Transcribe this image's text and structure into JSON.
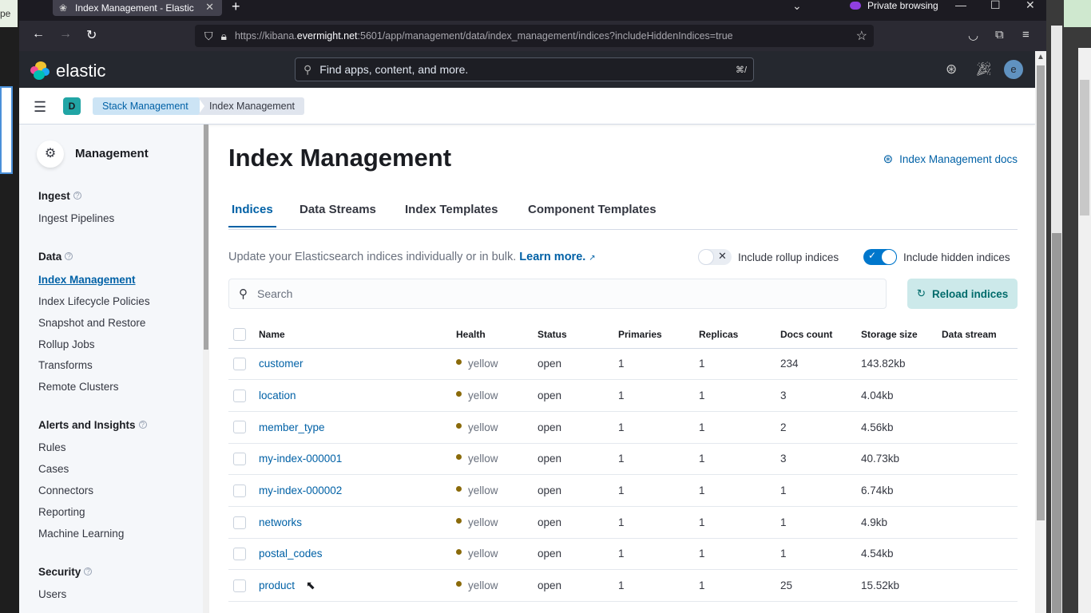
{
  "browser": {
    "tab_title": "Index Management - Elastic",
    "new_tab": "+",
    "private_label": "Private browsing",
    "url_prefix": "https://kibana.",
    "url_host": "evermight.net",
    "url_rest": ":5601/app/management/data/index_management/indices?includeHiddenIndices=true"
  },
  "left_strip_text": "pe",
  "kibana": {
    "logo_text": "elastic",
    "global_search_placeholder": "Find apps, content, and more.",
    "global_search_shortcut": "⌘/",
    "avatar_initial": "e",
    "space_initial": "D",
    "breadcrumbs": [
      "Stack Management",
      "Index Management"
    ]
  },
  "sidebar": {
    "title": "Management",
    "groups": [
      {
        "label": "Ingest",
        "items": [
          "Ingest Pipelines"
        ]
      },
      {
        "label": "Data",
        "items": [
          "Index Management",
          "Index Lifecycle Policies",
          "Snapshot and Restore",
          "Rollup Jobs",
          "Transforms",
          "Remote Clusters"
        ]
      },
      {
        "label": "Alerts and Insights",
        "items": [
          "Rules",
          "Cases",
          "Connectors",
          "Reporting",
          "Machine Learning"
        ]
      },
      {
        "label": "Security",
        "items": [
          "Users"
        ]
      }
    ],
    "active_item": "Index Management"
  },
  "main": {
    "title": "Index Management",
    "docs_link": "Index Management docs",
    "tabs": [
      "Indices",
      "Data Streams",
      "Index Templates",
      "Component Templates"
    ],
    "active_tab": "Indices",
    "description": "Update your Elasticsearch indices individually or in bulk.",
    "learn_more": "Learn more.",
    "toggle_rollup": {
      "label": "Include rollup indices",
      "on": false
    },
    "toggle_hidden": {
      "label": "Include hidden indices",
      "on": true
    },
    "search_placeholder": "Search",
    "search_value": "",
    "reload_button": "Reload indices"
  },
  "table": {
    "columns": [
      "Name",
      "Health",
      "Status",
      "Primaries",
      "Replicas",
      "Docs count",
      "Storage size",
      "Data stream"
    ],
    "rows": [
      {
        "name": "customer",
        "health": "yellow",
        "status": "open",
        "primaries": "1",
        "replicas": "1",
        "docs": "234",
        "size": "143.82kb",
        "stream": ""
      },
      {
        "name": "location",
        "health": "yellow",
        "status": "open",
        "primaries": "1",
        "replicas": "1",
        "docs": "3",
        "size": "4.04kb",
        "stream": ""
      },
      {
        "name": "member_type",
        "health": "yellow",
        "status": "open",
        "primaries": "1",
        "replicas": "1",
        "docs": "2",
        "size": "4.56kb",
        "stream": ""
      },
      {
        "name": "my-index-000001",
        "health": "yellow",
        "status": "open",
        "primaries": "1",
        "replicas": "1",
        "docs": "3",
        "size": "40.73kb",
        "stream": ""
      },
      {
        "name": "my-index-000002",
        "health": "yellow",
        "status": "open",
        "primaries": "1",
        "replicas": "1",
        "docs": "1",
        "size": "6.74kb",
        "stream": ""
      },
      {
        "name": "networks",
        "health": "yellow",
        "status": "open",
        "primaries": "1",
        "replicas": "1",
        "docs": "1",
        "size": "4.9kb",
        "stream": ""
      },
      {
        "name": "postal_codes",
        "health": "yellow",
        "status": "open",
        "primaries": "1",
        "replicas": "1",
        "docs": "1",
        "size": "4.54kb",
        "stream": ""
      },
      {
        "name": "product",
        "health": "yellow",
        "status": "open",
        "primaries": "1",
        "replicas": "1",
        "docs": "25",
        "size": "15.52kb",
        "stream": ""
      }
    ]
  },
  "colors": {
    "accent": "#0061a6",
    "health_yellow": "#8a6a0a",
    "header_bg": "#25282f",
    "reload_bg": "#cce9ea"
  }
}
